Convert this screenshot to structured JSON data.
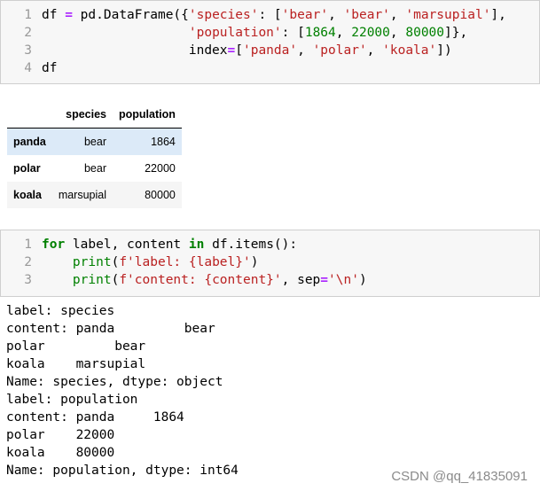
{
  "cell1": {
    "lines": [
      {
        "num": "1",
        "tokens": [
          {
            "t": "df ",
            "c": "plain"
          },
          {
            "t": "=",
            "c": "op"
          },
          {
            "t": " pd.DataFrame({",
            "c": "plain"
          },
          {
            "t": "'species'",
            "c": "str"
          },
          {
            "t": ": [",
            "c": "plain"
          },
          {
            "t": "'bear'",
            "c": "str"
          },
          {
            "t": ", ",
            "c": "plain"
          },
          {
            "t": "'bear'",
            "c": "str"
          },
          {
            "t": ", ",
            "c": "plain"
          },
          {
            "t": "'marsupial'",
            "c": "str"
          },
          {
            "t": "],",
            "c": "plain"
          }
        ]
      },
      {
        "num": "2",
        "tokens": [
          {
            "t": "                   ",
            "c": "plain"
          },
          {
            "t": "'population'",
            "c": "str"
          },
          {
            "t": ": [",
            "c": "plain"
          },
          {
            "t": "1864",
            "c": "num"
          },
          {
            "t": ", ",
            "c": "plain"
          },
          {
            "t": "22000",
            "c": "num"
          },
          {
            "t": ", ",
            "c": "plain"
          },
          {
            "t": "80000",
            "c": "num"
          },
          {
            "t": "]},",
            "c": "plain"
          }
        ]
      },
      {
        "num": "3",
        "tokens": [
          {
            "t": "                   index",
            "c": "plain"
          },
          {
            "t": "=",
            "c": "op"
          },
          {
            "t": "[",
            "c": "plain"
          },
          {
            "t": "'panda'",
            "c": "str"
          },
          {
            "t": ", ",
            "c": "plain"
          },
          {
            "t": "'polar'",
            "c": "str"
          },
          {
            "t": ", ",
            "c": "plain"
          },
          {
            "t": "'koala'",
            "c": "str"
          },
          {
            "t": "])",
            "c": "plain"
          }
        ]
      },
      {
        "num": "4",
        "tokens": [
          {
            "t": "df",
            "c": "plain"
          }
        ]
      }
    ]
  },
  "table": {
    "columns": [
      "",
      "species",
      "population"
    ],
    "rows": [
      {
        "index": "panda",
        "species": "bear",
        "population": "1864"
      },
      {
        "index": "polar",
        "species": "bear",
        "population": "22000"
      },
      {
        "index": "koala",
        "species": "marsupial",
        "population": "80000"
      }
    ]
  },
  "cell2": {
    "lines": [
      {
        "num": "1",
        "tokens": [
          {
            "t": "for",
            "c": "kw"
          },
          {
            "t": " label, content ",
            "c": "plain"
          },
          {
            "t": "in",
            "c": "kw"
          },
          {
            "t": " df.items():",
            "c": "plain"
          }
        ]
      },
      {
        "num": "2",
        "tokens": [
          {
            "t": "    ",
            "c": "plain"
          },
          {
            "t": "print",
            "c": "bi"
          },
          {
            "t": "(",
            "c": "plain"
          },
          {
            "t": "f'label: {label}'",
            "c": "str"
          },
          {
            "t": ")",
            "c": "plain"
          }
        ]
      },
      {
        "num": "3",
        "tokens": [
          {
            "t": "    ",
            "c": "plain"
          },
          {
            "t": "print",
            "c": "bi"
          },
          {
            "t": "(",
            "c": "plain"
          },
          {
            "t": "f'content: {content}'",
            "c": "str"
          },
          {
            "t": ", sep",
            "c": "plain"
          },
          {
            "t": "=",
            "c": "op"
          },
          {
            "t": "'\\n'",
            "c": "str"
          },
          {
            "t": ")",
            "c": "plain"
          }
        ]
      }
    ]
  },
  "output": [
    "label: species",
    "content: panda         bear",
    "polar         bear",
    "koala    marsupial",
    "Name: species, dtype: object",
    "label: population",
    "content: panda     1864",
    "polar    22000",
    "koala    80000",
    "Name: population, dtype: int64"
  ],
  "watermark": "CSDN @qq_41835091",
  "colors": {
    "keyword": "#008000",
    "operator": "#aa22ff",
    "string": "#ba2121",
    "number": "#008000",
    "line_number": "#999999",
    "cell_background": "#f7f7f7",
    "row_highlight": "#dceaf8"
  }
}
